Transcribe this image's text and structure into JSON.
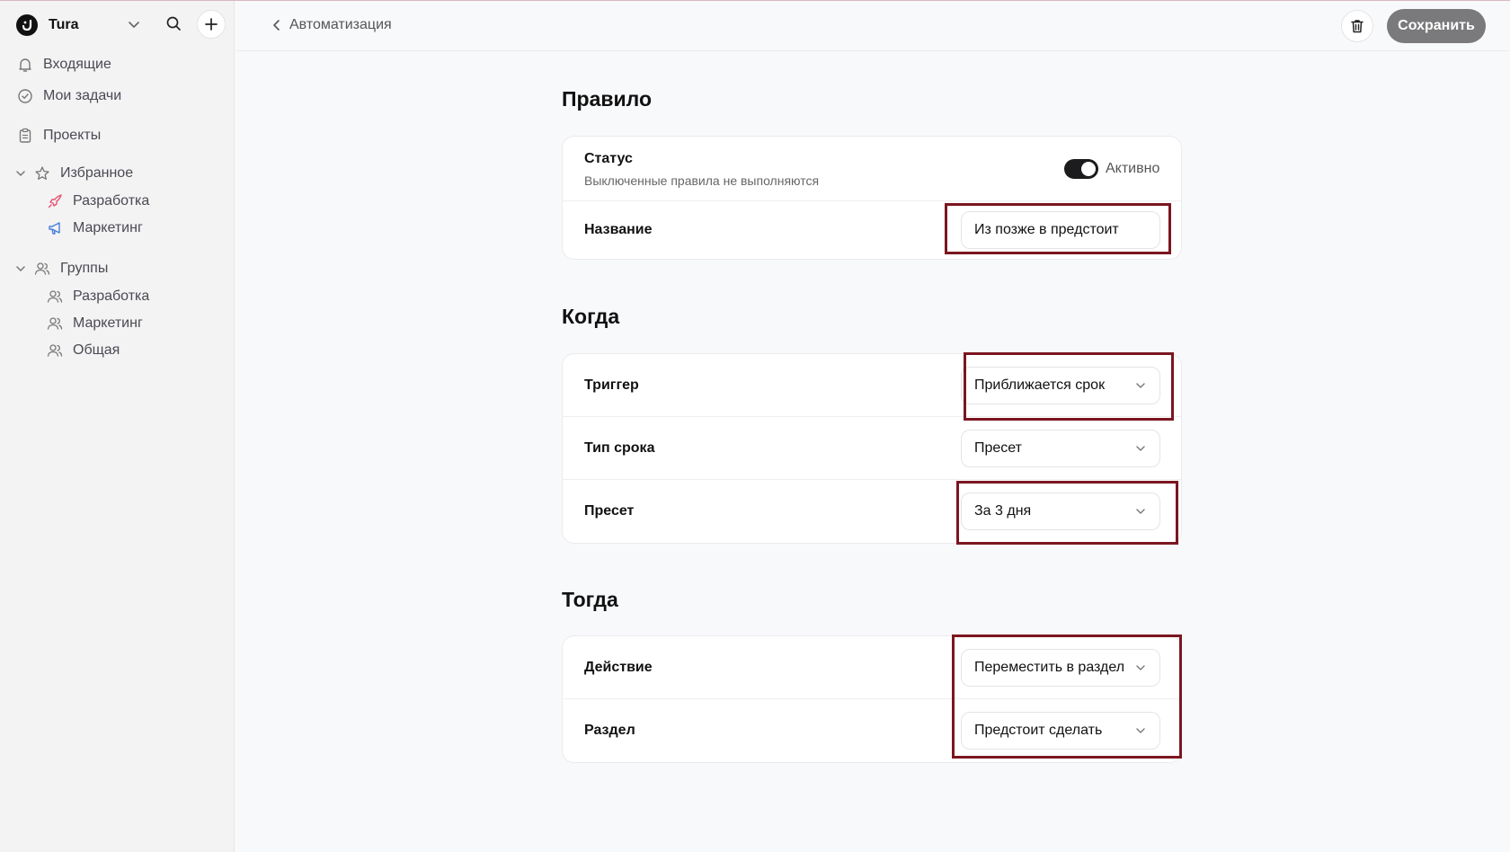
{
  "workspace": {
    "name": "Tura"
  },
  "sidebar": {
    "inbox": "Входящие",
    "my_tasks": "Мои задачи",
    "projects": "Проекты",
    "favorites": {
      "label": "Избранное",
      "items": [
        {
          "label": "Разработка"
        },
        {
          "label": "Маркетинг"
        }
      ]
    },
    "groups": {
      "label": "Группы",
      "items": [
        {
          "label": "Разработка"
        },
        {
          "label": "Маркетинг"
        },
        {
          "label": "Общая"
        }
      ]
    }
  },
  "header": {
    "back_label": "Автоматизация",
    "save_label": "Сохранить"
  },
  "rule": {
    "title": "Правило",
    "status_label": "Статус",
    "status_hint": "Выключенные правила не выполняются",
    "status_value": "Активно",
    "status_on": true,
    "name_label": "Название",
    "name_value": "Из позже в предстоит"
  },
  "when": {
    "title": "Когда",
    "trigger_label": "Триггер",
    "trigger_value": "Приближается срок",
    "due_type_label": "Тип срока",
    "due_type_value": "Пресет",
    "preset_label": "Пресет",
    "preset_value": "За 3 дня"
  },
  "then": {
    "title": "Тогда",
    "action_label": "Действие",
    "action_value": "Переместить в раздел",
    "section_label": "Раздел",
    "section_value": "Предстоит сделать"
  },
  "colors": {
    "highlight": "#7b1620",
    "save_button": "#7a7a7c",
    "favorite_dev_icon": "#e8506e",
    "favorite_marketing_icon": "#4a7fd6"
  }
}
